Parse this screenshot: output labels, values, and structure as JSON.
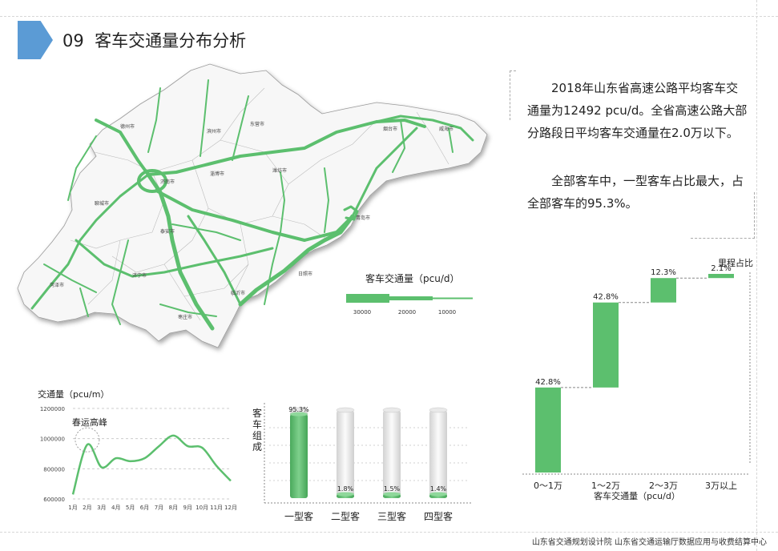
{
  "header": {
    "number": "09",
    "title": "客车交通量分布分析"
  },
  "summary": {
    "p1": "2018年山东省高速公路平均客车交通量为12492 pcu/d。全省高速公路大部分路段日平均客车交通量在2.0万以下。",
    "p2": "全部客车中，一型客车占比最大，占全部客车的95.3%。"
  },
  "map": {
    "legend_title": "客车交通量（pcu/d）",
    "legend_ticks": [
      "30000",
      "20000",
      "10000"
    ],
    "road_color": "#5cbf6e",
    "cities": [
      "德州市",
      "滨州市",
      "东营市",
      "烟台市",
      "威海市",
      "济南市",
      "淄博市",
      "潍坊市",
      "聊城市",
      "泰安市",
      "青岛市",
      "济宁市",
      "日照市",
      "菏泽市",
      "临沂市",
      "枣庄市"
    ]
  },
  "colors": {
    "accent_blue": "#5b9bd5",
    "green": "#5cbf6e"
  },
  "footer": "山东省交通规划设计院   山东省交通运输厅数据应用与收费结算中心",
  "chart_data": [
    {
      "type": "line",
      "ylabel": "交通量（pcu/m）",
      "x": [
        "1月",
        "2月",
        "3月",
        "4月",
        "5月",
        "6月",
        "7月",
        "8月",
        "9月",
        "10月",
        "11月",
        "12月"
      ],
      "values": [
        630000,
        960000,
        810000,
        870000,
        850000,
        870000,
        950000,
        1020000,
        950000,
        940000,
        820000,
        720000
      ],
      "yticks": [
        600000,
        800000,
        1000000,
        1200000
      ],
      "ylim": [
        600000,
        1200000
      ],
      "annotation": "春运高峰",
      "grid": true
    },
    {
      "type": "bar",
      "ylabel": "客车组成",
      "categories": [
        "一型客",
        "二型客",
        "三型客",
        "四型客"
      ],
      "values": [
        95.3,
        1.8,
        1.5,
        1.4
      ],
      "labels": [
        "95.3%",
        "1.8%",
        "1.5%",
        "1.4%"
      ],
      "ylim": [
        0,
        100
      ]
    },
    {
      "type": "bar",
      "subtype": "waterfall",
      "ylabel": "里程占比",
      "xlabel": "客车交通量（pcu/d）",
      "categories": [
        "0～1万",
        "1～2万",
        "2～3万",
        "3万以上"
      ],
      "values": [
        42.8,
        42.8,
        12.3,
        2.1
      ],
      "labels": [
        "42.8%",
        "42.8%",
        "12.3%",
        "2.1%"
      ],
      "ylim": [
        0,
        100
      ]
    }
  ]
}
